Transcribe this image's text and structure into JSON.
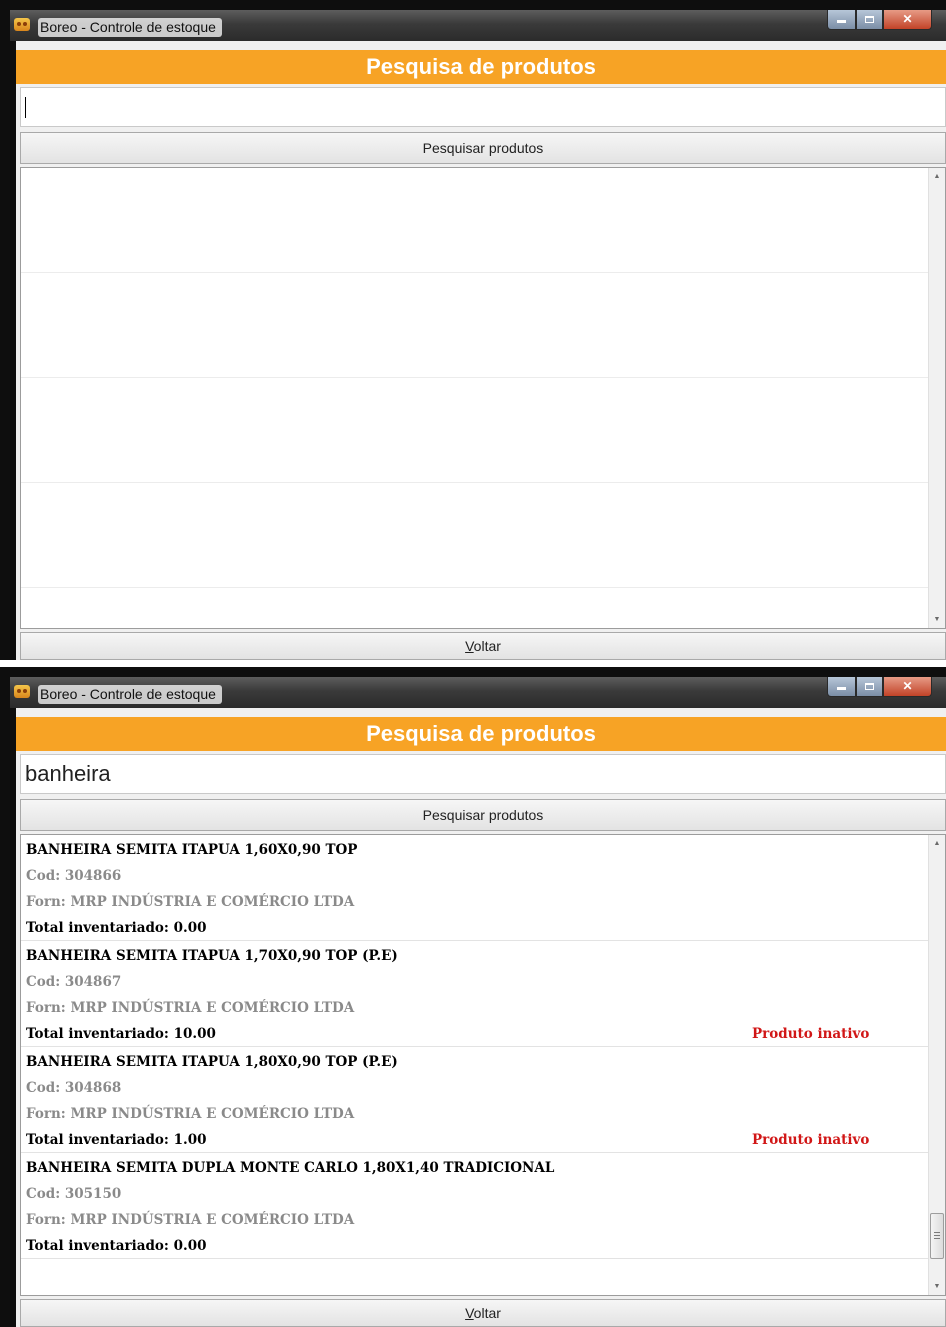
{
  "window_top": {
    "title": "Boreo - Controle de estoque",
    "header": "Pesquisa de produtos",
    "search_value": "",
    "search_button": "Pesquisar produtos",
    "back_button": "Voltar"
  },
  "window_bottom": {
    "title": "Boreo - Controle de estoque",
    "header": "Pesquisa de produtos",
    "search_value": "banheira",
    "search_button": "Pesquisar produtos",
    "back_button": "Voltar",
    "products": [
      {
        "name": "BANHEIRA SEMITA  ITAPUA 1,60X0,90 TOP",
        "cod": "Cod: 304866",
        "forn": "Forn: MRP INDÚSTRIA E COMÉRCIO LTDA",
        "total": "Total inventariado: 0.00",
        "status": ""
      },
      {
        "name": "BANHEIRA SEMITA  ITAPUA 1,70X0,90 TOP (P.E)",
        "cod": "Cod: 304867",
        "forn": "Forn: MRP INDÚSTRIA E COMÉRCIO LTDA",
        "total": "Total inventariado: 10.00",
        "status": "Produto inativo"
      },
      {
        "name": "BANHEIRA SEMITA  ITAPUA 1,80X0,90 TOP (P.E)",
        "cod": "Cod: 304868",
        "forn": "Forn: MRP INDÚSTRIA E COMÉRCIO LTDA",
        "total": "Total inventariado: 1.00",
        "status": "Produto inativo"
      },
      {
        "name": "BANHEIRA SEMITA DUPLA MONTE CARLO 1,80X1,40 TRADICIONAL",
        "cod": "Cod: 305150",
        "forn": "Forn: MRP INDÚSTRIA E COMÉRCIO LTDA",
        "total": "Total inventariado: 0.00",
        "status": ""
      }
    ]
  },
  "icons": [
    "app-icon",
    "minimize-icon",
    "maximize-icon",
    "close-icon",
    "scroll-up-icon",
    "scroll-down-icon"
  ],
  "colors": {
    "header_orange": "#f7a325",
    "inactive_red": "#d11616",
    "meta_gray": "#8a8a8a"
  }
}
